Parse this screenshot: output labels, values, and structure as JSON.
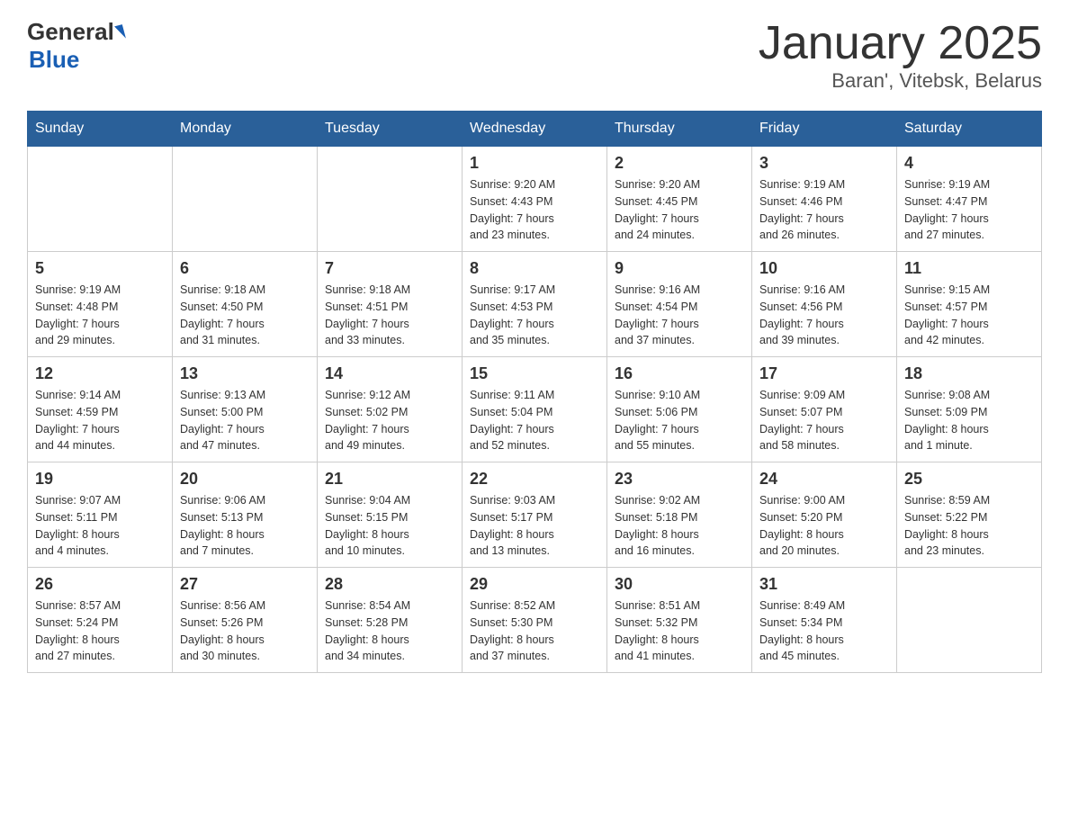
{
  "header": {
    "logo_general": "General",
    "logo_blue": "Blue",
    "title": "January 2025",
    "subtitle": "Baran', Vitebsk, Belarus"
  },
  "days_of_week": [
    "Sunday",
    "Monday",
    "Tuesday",
    "Wednesday",
    "Thursday",
    "Friday",
    "Saturday"
  ],
  "weeks": [
    [
      {
        "day": "",
        "info": ""
      },
      {
        "day": "",
        "info": ""
      },
      {
        "day": "",
        "info": ""
      },
      {
        "day": "1",
        "info": "Sunrise: 9:20 AM\nSunset: 4:43 PM\nDaylight: 7 hours\nand 23 minutes."
      },
      {
        "day": "2",
        "info": "Sunrise: 9:20 AM\nSunset: 4:45 PM\nDaylight: 7 hours\nand 24 minutes."
      },
      {
        "day": "3",
        "info": "Sunrise: 9:19 AM\nSunset: 4:46 PM\nDaylight: 7 hours\nand 26 minutes."
      },
      {
        "day": "4",
        "info": "Sunrise: 9:19 AM\nSunset: 4:47 PM\nDaylight: 7 hours\nand 27 minutes."
      }
    ],
    [
      {
        "day": "5",
        "info": "Sunrise: 9:19 AM\nSunset: 4:48 PM\nDaylight: 7 hours\nand 29 minutes."
      },
      {
        "day": "6",
        "info": "Sunrise: 9:18 AM\nSunset: 4:50 PM\nDaylight: 7 hours\nand 31 minutes."
      },
      {
        "day": "7",
        "info": "Sunrise: 9:18 AM\nSunset: 4:51 PM\nDaylight: 7 hours\nand 33 minutes."
      },
      {
        "day": "8",
        "info": "Sunrise: 9:17 AM\nSunset: 4:53 PM\nDaylight: 7 hours\nand 35 minutes."
      },
      {
        "day": "9",
        "info": "Sunrise: 9:16 AM\nSunset: 4:54 PM\nDaylight: 7 hours\nand 37 minutes."
      },
      {
        "day": "10",
        "info": "Sunrise: 9:16 AM\nSunset: 4:56 PM\nDaylight: 7 hours\nand 39 minutes."
      },
      {
        "day": "11",
        "info": "Sunrise: 9:15 AM\nSunset: 4:57 PM\nDaylight: 7 hours\nand 42 minutes."
      }
    ],
    [
      {
        "day": "12",
        "info": "Sunrise: 9:14 AM\nSunset: 4:59 PM\nDaylight: 7 hours\nand 44 minutes."
      },
      {
        "day": "13",
        "info": "Sunrise: 9:13 AM\nSunset: 5:00 PM\nDaylight: 7 hours\nand 47 minutes."
      },
      {
        "day": "14",
        "info": "Sunrise: 9:12 AM\nSunset: 5:02 PM\nDaylight: 7 hours\nand 49 minutes."
      },
      {
        "day": "15",
        "info": "Sunrise: 9:11 AM\nSunset: 5:04 PM\nDaylight: 7 hours\nand 52 minutes."
      },
      {
        "day": "16",
        "info": "Sunrise: 9:10 AM\nSunset: 5:06 PM\nDaylight: 7 hours\nand 55 minutes."
      },
      {
        "day": "17",
        "info": "Sunrise: 9:09 AM\nSunset: 5:07 PM\nDaylight: 7 hours\nand 58 minutes."
      },
      {
        "day": "18",
        "info": "Sunrise: 9:08 AM\nSunset: 5:09 PM\nDaylight: 8 hours\nand 1 minute."
      }
    ],
    [
      {
        "day": "19",
        "info": "Sunrise: 9:07 AM\nSunset: 5:11 PM\nDaylight: 8 hours\nand 4 minutes."
      },
      {
        "day": "20",
        "info": "Sunrise: 9:06 AM\nSunset: 5:13 PM\nDaylight: 8 hours\nand 7 minutes."
      },
      {
        "day": "21",
        "info": "Sunrise: 9:04 AM\nSunset: 5:15 PM\nDaylight: 8 hours\nand 10 minutes."
      },
      {
        "day": "22",
        "info": "Sunrise: 9:03 AM\nSunset: 5:17 PM\nDaylight: 8 hours\nand 13 minutes."
      },
      {
        "day": "23",
        "info": "Sunrise: 9:02 AM\nSunset: 5:18 PM\nDaylight: 8 hours\nand 16 minutes."
      },
      {
        "day": "24",
        "info": "Sunrise: 9:00 AM\nSunset: 5:20 PM\nDaylight: 8 hours\nand 20 minutes."
      },
      {
        "day": "25",
        "info": "Sunrise: 8:59 AM\nSunset: 5:22 PM\nDaylight: 8 hours\nand 23 minutes."
      }
    ],
    [
      {
        "day": "26",
        "info": "Sunrise: 8:57 AM\nSunset: 5:24 PM\nDaylight: 8 hours\nand 27 minutes."
      },
      {
        "day": "27",
        "info": "Sunrise: 8:56 AM\nSunset: 5:26 PM\nDaylight: 8 hours\nand 30 minutes."
      },
      {
        "day": "28",
        "info": "Sunrise: 8:54 AM\nSunset: 5:28 PM\nDaylight: 8 hours\nand 34 minutes."
      },
      {
        "day": "29",
        "info": "Sunrise: 8:52 AM\nSunset: 5:30 PM\nDaylight: 8 hours\nand 37 minutes."
      },
      {
        "day": "30",
        "info": "Sunrise: 8:51 AM\nSunset: 5:32 PM\nDaylight: 8 hours\nand 41 minutes."
      },
      {
        "day": "31",
        "info": "Sunrise: 8:49 AM\nSunset: 5:34 PM\nDaylight: 8 hours\nand 45 minutes."
      },
      {
        "day": "",
        "info": ""
      }
    ]
  ]
}
